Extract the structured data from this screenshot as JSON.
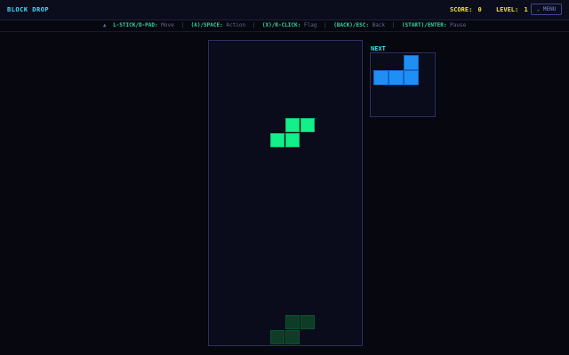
{
  "app": {
    "title": "BLOCK DROP"
  },
  "header": {
    "score_label": "SCORE:",
    "score_value": "0",
    "level_label": "LEVEL:",
    "level_value": "1",
    "menu_label": "⌄ MENU"
  },
  "controls": {
    "glyph": "▲",
    "items": [
      {
        "key": "L-STICK/D-PAD:",
        "action": "Move"
      },
      {
        "key": "(A)/SPACE:",
        "action": "Action"
      },
      {
        "key": "(X)/R-CLICK:",
        "action": "Flag"
      },
      {
        "key": "(BACK)/ESC:",
        "action": "Back"
      },
      {
        "key": "(START)/ENTER:",
        "action": "Pause"
      }
    ],
    "separator": "|"
  },
  "next": {
    "label": "NEXT",
    "piece": "L",
    "color": "#1f8ff5"
  },
  "board": {
    "active_piece": "S",
    "active_color": "#12f08a",
    "ghost_color": "#0d3d26"
  },
  "colors": {
    "accent": "#3ee0ff",
    "score": "#f4e43a",
    "key": "#35d6a6"
  }
}
